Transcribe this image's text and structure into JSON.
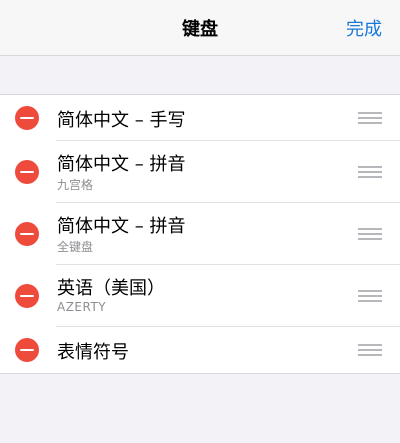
{
  "navbar": {
    "title": "键盘",
    "done_label": "完成"
  },
  "keyboards": [
    {
      "title": "简体中文 – 手写",
      "subtitle": ""
    },
    {
      "title": "简体中文 – 拼音",
      "subtitle": "九宫格"
    },
    {
      "title": "简体中文 – 拼音",
      "subtitle": "全键盘"
    },
    {
      "title": "英语（美国）",
      "subtitle": "AZERTY"
    },
    {
      "title": "表情符号",
      "subtitle": ""
    }
  ],
  "colors": {
    "accent": "#1a78d8",
    "delete": "#ee4b3c",
    "background": "#f2f2f7"
  },
  "icons": {
    "delete": "minus-circle-icon",
    "reorder": "reorder-handle-icon"
  }
}
